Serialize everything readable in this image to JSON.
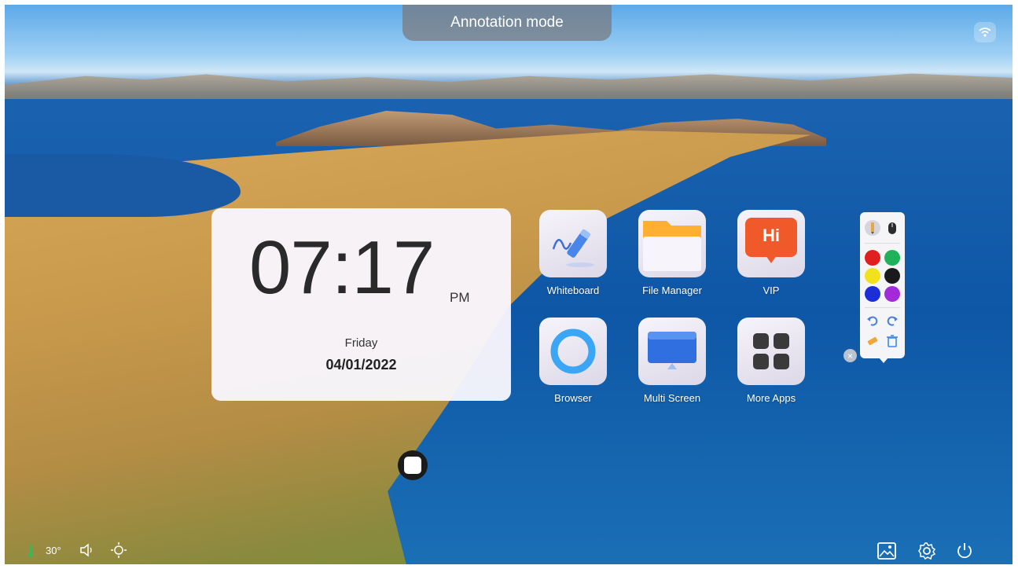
{
  "top_bar": {
    "mode_label": "Annotation mode"
  },
  "clock": {
    "time": "07:17",
    "ampm": "PM",
    "day": "Friday",
    "date": "04/01/2022"
  },
  "apps": [
    {
      "label": "Whiteboard"
    },
    {
      "label": "File Manager"
    },
    {
      "label": "VIP",
      "badge": "Hi"
    },
    {
      "label": "Browser"
    },
    {
      "label": "Multi Screen"
    },
    {
      "label": "More Apps"
    }
  ],
  "toolbar": {
    "colors": [
      "#e02020",
      "#1fb25a",
      "#f2e21c",
      "#1a1a1a",
      "#1c2fd6",
      "#a22ad8"
    ]
  },
  "status_bar": {
    "temperature": "30°"
  }
}
